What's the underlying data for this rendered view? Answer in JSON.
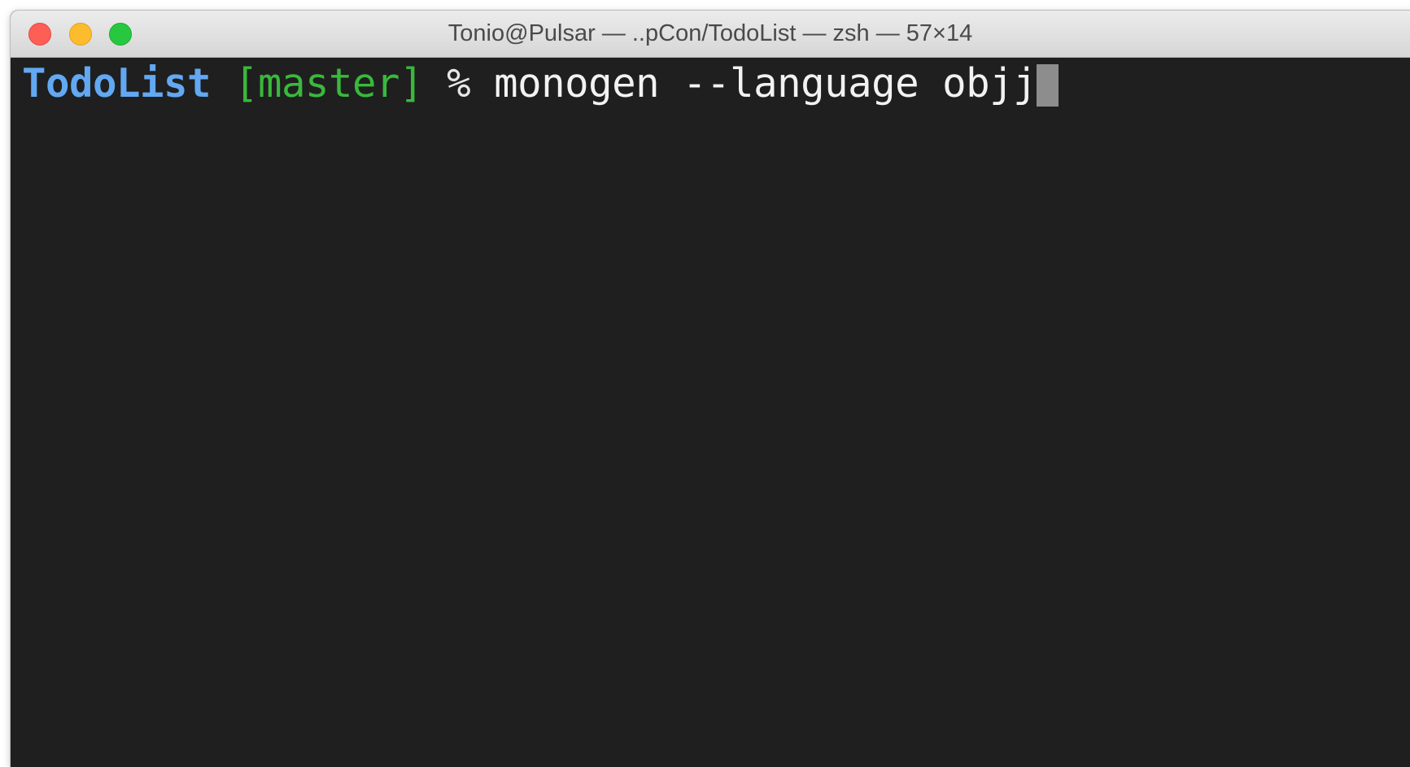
{
  "window": {
    "title": "Tonio@Pulsar — ..pCon/TodoList — zsh — 57×14",
    "buttons": {
      "close_color": "#fd5f57",
      "minimize_color": "#fdbc2e",
      "zoom_color": "#27c840"
    }
  },
  "terminal": {
    "background": "#1f1f1f",
    "prompt": {
      "directory": "TodoList",
      "branch": "[master]",
      "symbol": "%",
      "directory_color": "#62a8f2",
      "branch_color": "#39b93c"
    },
    "command": "monogen --language objj",
    "cursor": "block-cursor"
  }
}
